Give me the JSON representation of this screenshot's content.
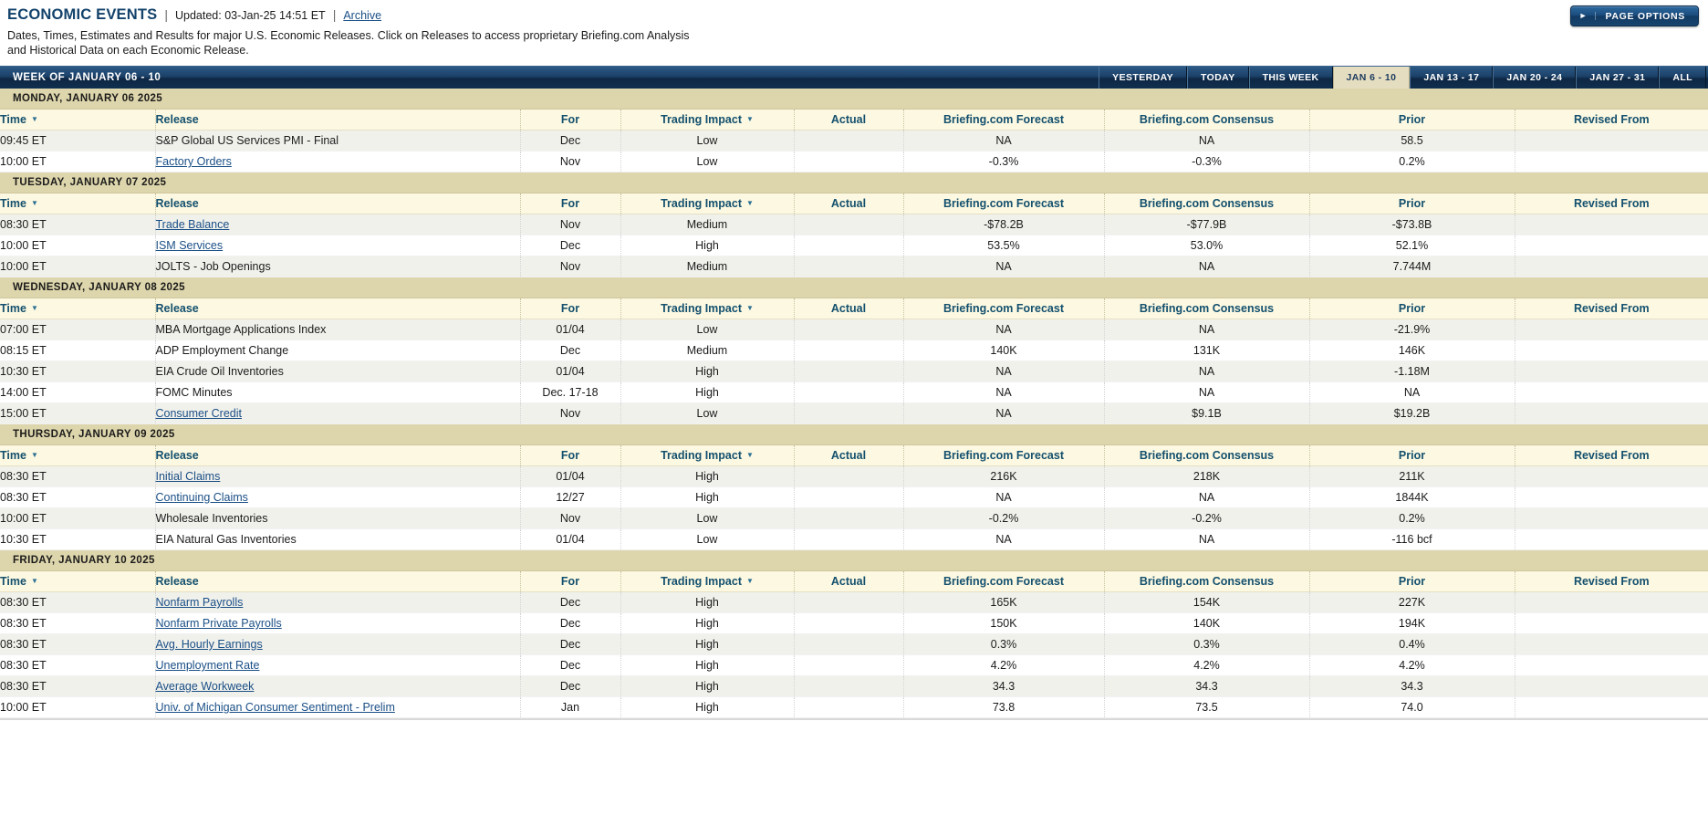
{
  "header": {
    "title": "ECONOMIC EVENTS",
    "separator": "|",
    "updated": "Updated: 03-Jan-25 14:51 ET",
    "archive_label": "Archive",
    "description": "Dates, Times, Estimates and Results for major U.S. Economic Releases. Click on Releases to access proprietary Briefing.com Analysis and Historical Data on each Economic Release.",
    "page_options_label": "PAGE OPTIONS",
    "page_options_icon": "play-triangle-icon"
  },
  "week_bar": {
    "label": "WEEK OF JANUARY 06 - 10",
    "tabs": [
      {
        "label": "YESTERDAY",
        "active": false
      },
      {
        "label": "TODAY",
        "active": false
      },
      {
        "label": "THIS WEEK",
        "active": false
      },
      {
        "label": "JAN 6 - 10",
        "active": true
      },
      {
        "label": "JAN 13 - 17",
        "active": false
      },
      {
        "label": "JAN 20 - 24",
        "active": false
      },
      {
        "label": "JAN 27 - 31",
        "active": false
      },
      {
        "label": "ALL",
        "active": false
      }
    ]
  },
  "columns": {
    "time": "Time",
    "release": "Release",
    "for": "For",
    "impact": "Trading Impact",
    "actual": "Actual",
    "forecast": "Briefing.com Forecast",
    "consensus": "Briefing.com Consensus",
    "prior": "Prior",
    "revised": "Revised From"
  },
  "sortable": [
    "time",
    "impact"
  ],
  "colors": {
    "brand_blue": "#13426b",
    "link_blue": "#1a4f86",
    "day_header_bg": "#ddd5ab",
    "col_header_bg": "#fcf8e1",
    "row_odd_bg": "#f1f1ec",
    "active_tab_bg": "#e5ddc0"
  },
  "days": [
    {
      "name": "MONDAY, JANUARY 06 2025",
      "rows": [
        {
          "time": "09:45 ET",
          "release": "S&P Global US Services PMI - Final",
          "link": false,
          "for": "Dec",
          "impact": "Low",
          "actual": "",
          "forecast": "NA",
          "consensus": "NA",
          "prior": "58.5",
          "revised": ""
        },
        {
          "time": "10:00 ET",
          "release": "Factory Orders",
          "link": true,
          "for": "Nov",
          "impact": "Low",
          "actual": "",
          "forecast": "-0.3%",
          "consensus": "-0.3%",
          "prior": "0.2%",
          "revised": ""
        }
      ]
    },
    {
      "name": "TUESDAY, JANUARY 07 2025",
      "rows": [
        {
          "time": "08:30 ET",
          "release": "Trade Balance",
          "link": true,
          "for": "Nov",
          "impact": "Medium",
          "actual": "",
          "forecast": "-$78.2B",
          "consensus": "-$77.9B",
          "prior": "-$73.8B",
          "revised": ""
        },
        {
          "time": "10:00 ET",
          "release": "ISM Services",
          "link": true,
          "for": "Dec",
          "impact": "High",
          "actual": "",
          "forecast": "53.5%",
          "consensus": "53.0%",
          "prior": "52.1%",
          "revised": ""
        },
        {
          "time": "10:00 ET",
          "release": "JOLTS - Job Openings",
          "link": false,
          "for": "Nov",
          "impact": "Medium",
          "actual": "",
          "forecast": "NA",
          "consensus": "NA",
          "prior": "7.744M",
          "revised": ""
        }
      ]
    },
    {
      "name": "WEDNESDAY, JANUARY 08 2025",
      "rows": [
        {
          "time": "07:00 ET",
          "release": "MBA Mortgage Applications Index",
          "link": false,
          "for": "01/04",
          "impact": "Low",
          "actual": "",
          "forecast": "NA",
          "consensus": "NA",
          "prior": "-21.9%",
          "revised": ""
        },
        {
          "time": "08:15 ET",
          "release": "ADP Employment Change",
          "link": false,
          "for": "Dec",
          "impact": "Medium",
          "actual": "",
          "forecast": "140K",
          "consensus": "131K",
          "prior": "146K",
          "revised": ""
        },
        {
          "time": "10:30 ET",
          "release": "EIA Crude Oil Inventories",
          "link": false,
          "for": "01/04",
          "impact": "High",
          "actual": "",
          "forecast": "NA",
          "consensus": "NA",
          "prior": "-1.18M",
          "revised": ""
        },
        {
          "time": "14:00 ET",
          "release": "FOMC Minutes",
          "link": false,
          "for": "Dec. 17-18",
          "impact": "High",
          "actual": "",
          "forecast": "NA",
          "consensus": "NA",
          "prior": "NA",
          "revised": ""
        },
        {
          "time": "15:00 ET",
          "release": "Consumer Credit",
          "link": true,
          "for": "Nov",
          "impact": "Low",
          "actual": "",
          "forecast": "NA",
          "consensus": "$9.1B",
          "prior": "$19.2B",
          "revised": ""
        }
      ]
    },
    {
      "name": "THURSDAY, JANUARY 09 2025",
      "rows": [
        {
          "time": "08:30 ET",
          "release": "Initial Claims",
          "link": true,
          "for": "01/04",
          "impact": "High",
          "actual": "",
          "forecast": "216K",
          "consensus": "218K",
          "prior": "211K",
          "revised": ""
        },
        {
          "time": "08:30 ET",
          "release": "Continuing Claims",
          "link": true,
          "for": "12/27",
          "impact": "High",
          "actual": "",
          "forecast": "NA",
          "consensus": "NA",
          "prior": "1844K",
          "revised": ""
        },
        {
          "time": "10:00 ET",
          "release": "Wholesale Inventories",
          "link": false,
          "for": "Nov",
          "impact": "Low",
          "actual": "",
          "forecast": "-0.2%",
          "consensus": "-0.2%",
          "prior": "0.2%",
          "revised": ""
        },
        {
          "time": "10:30 ET",
          "release": "EIA Natural Gas Inventories",
          "link": false,
          "for": "01/04",
          "impact": "Low",
          "actual": "",
          "forecast": "NA",
          "consensus": "NA",
          "prior": "-116 bcf",
          "revised": ""
        }
      ]
    },
    {
      "name": "FRIDAY, JANUARY 10 2025",
      "rows": [
        {
          "time": "08:30 ET",
          "release": "Nonfarm Payrolls",
          "link": true,
          "for": "Dec",
          "impact": "High",
          "actual": "",
          "forecast": "165K",
          "consensus": "154K",
          "prior": "227K",
          "revised": ""
        },
        {
          "time": "08:30 ET",
          "release": "Nonfarm Private Payrolls",
          "link": true,
          "for": "Dec",
          "impact": "High",
          "actual": "",
          "forecast": "150K",
          "consensus": "140K",
          "prior": "194K",
          "revised": ""
        },
        {
          "time": "08:30 ET",
          "release": "Avg. Hourly Earnings",
          "link": true,
          "for": "Dec",
          "impact": "High",
          "actual": "",
          "forecast": "0.3%",
          "consensus": "0.3%",
          "prior": "0.4%",
          "revised": ""
        },
        {
          "time": "08:30 ET",
          "release": "Unemployment Rate",
          "link": true,
          "for": "Dec",
          "impact": "High",
          "actual": "",
          "forecast": "4.2%",
          "consensus": "4.2%",
          "prior": "4.2%",
          "revised": ""
        },
        {
          "time": "08:30 ET",
          "release": "Average Workweek",
          "link": true,
          "for": "Dec",
          "impact": "High",
          "actual": "",
          "forecast": "34.3",
          "consensus": "34.3",
          "prior": "34.3",
          "revised": ""
        },
        {
          "time": "10:00 ET",
          "release": "Univ. of Michigan Consumer Sentiment - Prelim",
          "link": true,
          "for": "Jan",
          "impact": "High",
          "actual": "",
          "forecast": "73.8",
          "consensus": "73.5",
          "prior": "74.0",
          "revised": ""
        }
      ]
    }
  ]
}
